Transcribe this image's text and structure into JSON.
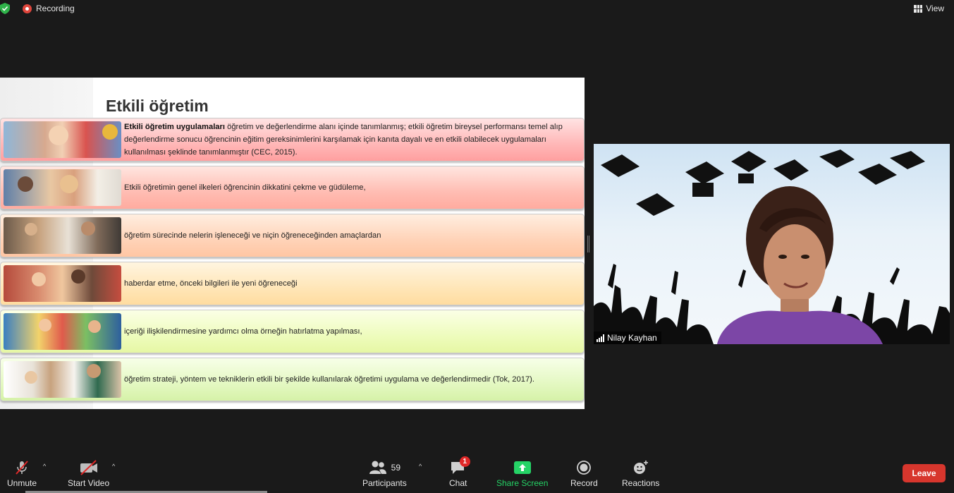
{
  "topbar": {
    "recording_label": "Recording",
    "view_label": "View"
  },
  "slide": {
    "title": "Etkili öğretim",
    "rows": [
      {
        "bold": "Etkili öğretim uygulamaları",
        "text": " öğretim ve değerlendirme alanı içinde tanımlanmış; etkili öğretim bireysel performansı temel alıp değerlendirme sonucu öğrencinin eğitim gereksinimlerini karşılamak için kanıta dayalı ve en etkili olabilecek uygulamaları kullanılması şeklinde tanımlanmıştır (CEC, 2015)."
      },
      {
        "bold": "",
        "text": "Etkili öğretimin genel ilkeleri öğrencinin dikkatini çekme ve güdüleme,"
      },
      {
        "bold": "",
        "text": "öğretim sürecinde nelerin işleneceği ve niçin öğreneceğinden amaçlardan"
      },
      {
        "bold": "",
        "text": "haberdar etme, önceki bilgileri ile yeni öğreneceği"
      },
      {
        "bold": "",
        "text": "içeriği ilişkilendirmesine yardımcı olma örneğin hatırlatma yapılması,"
      },
      {
        "bold": "",
        "text": "öğretim strateji, yöntem ve tekniklerin etkili bir şekilde kullanılarak öğretimi uygulama ve değerlendirmedir (Tok, 2017)."
      }
    ]
  },
  "video": {
    "participant_name": "Nilay Kayhan"
  },
  "toolbar": {
    "unmute_label": "Unmute",
    "start_video_label": "Start Video",
    "participants_label": "Participants",
    "participants_count": "59",
    "chat_label": "Chat",
    "chat_badge": "1",
    "share_screen_label": "Share Screen",
    "record_label": "Record",
    "reactions_label": "Reactions",
    "leave_label": "Leave"
  },
  "colors": {
    "background": "#1a1a1a",
    "share_green": "#25d366",
    "leave_red": "#d7362d",
    "badge_red": "#e02828",
    "recording_red": "#e0463c"
  }
}
